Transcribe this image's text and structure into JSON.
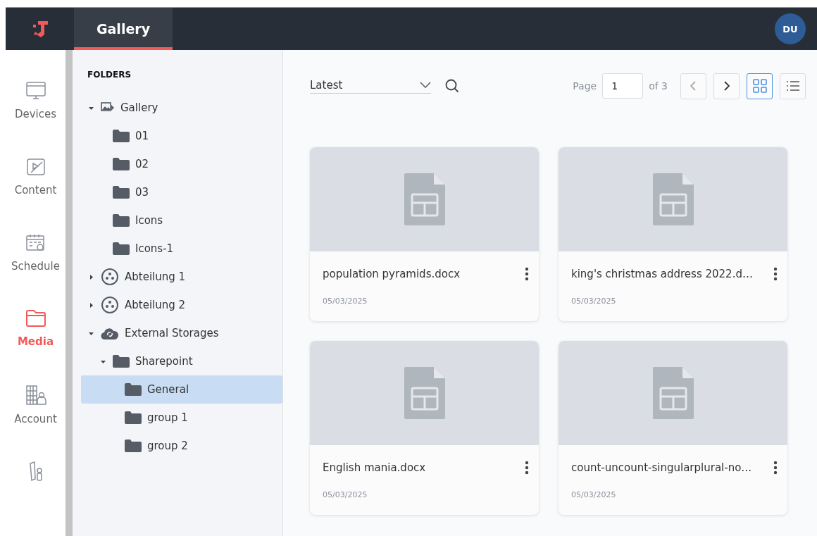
{
  "header": {
    "tab": "Gallery",
    "avatar": "DU"
  },
  "nav": [
    {
      "kind": "devices",
      "label": "Devices",
      "selected": false
    },
    {
      "kind": "content",
      "label": "Content",
      "selected": false
    },
    {
      "kind": "schedule",
      "label": "Schedule",
      "selected": false
    },
    {
      "kind": "media",
      "label": "Media",
      "selected": true
    },
    {
      "kind": "account",
      "label": "Account",
      "selected": false
    },
    {
      "kind": "tools",
      "selected": false
    }
  ],
  "folders": {
    "title": "FOLDERS",
    "tree": [
      {
        "kind": "gallery",
        "label": "Gallery",
        "expanded": true,
        "selected": false,
        "children": [
          {
            "kind": "folder",
            "label": "01",
            "selected": false
          },
          {
            "kind": "folder",
            "label": "02",
            "selected": false
          },
          {
            "kind": "folder",
            "label": "03",
            "selected": false
          },
          {
            "kind": "folder",
            "label": "Icons",
            "selected": false
          },
          {
            "kind": "folder",
            "label": "Icons-1",
            "selected": false
          }
        ]
      },
      {
        "kind": "department",
        "label": "Abteilung 1",
        "expanded": false,
        "selected": false
      },
      {
        "kind": "department",
        "label": "Abteilung 2",
        "expanded": false,
        "selected": false
      },
      {
        "kind": "cloud",
        "label": "External Storages",
        "expanded": true,
        "selected": false,
        "children": [
          {
            "kind": "folder",
            "label": "Sharepoint",
            "expanded": true,
            "selected": false,
            "children": [
              {
                "kind": "folder",
                "label": "General",
                "selected": true
              },
              {
                "kind": "folder",
                "label": "group 1",
                "selected": false
              },
              {
                "kind": "folder",
                "label": "group 2",
                "selected": false
              }
            ]
          }
        ]
      }
    ]
  },
  "toolbar": {
    "sort": "Latest",
    "page_label": "Page",
    "page": "1",
    "page_total": "of 3",
    "prev_disabled": true,
    "next_disabled": false,
    "views": [
      {
        "kind": "grid",
        "selected": true
      },
      {
        "kind": "list",
        "selected": false
      }
    ]
  },
  "files": [
    {
      "name": "population pyramids.docx",
      "date": "05/03/2025"
    },
    {
      "name": "king's christmas address 2022.d…",
      "date": "05/03/2025"
    },
    {
      "name": "English mania.docx",
      "date": "05/03/2025"
    },
    {
      "name": "count-uncount-singularplural-no…",
      "date": "05/03/2025"
    }
  ]
}
